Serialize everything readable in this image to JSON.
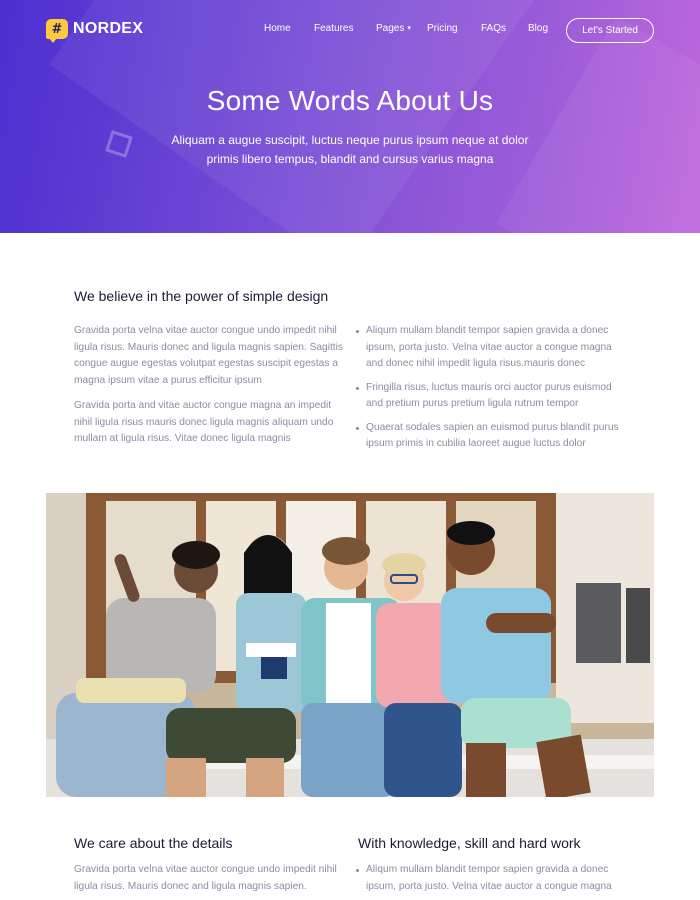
{
  "brand": {
    "logo_glyph": "#",
    "name": "NORDEX",
    "logo_color": "#ffc93c"
  },
  "nav": {
    "items": [
      {
        "label": "Home"
      },
      {
        "label": "Features"
      },
      {
        "label": "Pages"
      },
      {
        "label": "Pricing"
      },
      {
        "label": "FAQs"
      },
      {
        "label": "Blog"
      }
    ],
    "cta_label": "Let's Started"
  },
  "hero": {
    "title": "Some Words About Us",
    "subtitle": "Aliquam a augue suscipit, luctus neque purus ipsum neque at dolor primis libero tempus, blandit and cursus varius magna",
    "gradient_start": "#4b2fd0",
    "gradient_end": "#c069dd"
  },
  "section1": {
    "heading": "We believe in the power of simple design",
    "paragraphs": [
      "Gravida porta velna vitae auctor congue undo impedit nihil ligula risus. Mauris donec and ligula magnis sapien. Sagittis congue augue egestas volutpat egestas suscipit egestas a magna ipsum vitae a purus efficitur ipsum",
      "Gravida porta and vitae auctor congue magna an impedit nihil ligula risus mauris donec ligula magnis aliquam undo mullam at ligula risus. Vitae donec ligula magnis"
    ],
    "bullets": [
      "Aliqum mullam blandit tempor sapien gravida a donec ipsum, porta justo. Velna vitae auctor a congue magna and donec nihil impedit ligula risus.mauris donec",
      "Fringilla risus, luctus mauris orci auctor purus euismod and pretium purus pretium ligula rutrum tempor",
      "Quaerat sodales sapien an euismod purus blandit purus ipsum primis in cubilia laoreet augue luctus dolor"
    ]
  },
  "section2": {
    "left_heading": "We care about the details",
    "left_paragraph": "Gravida porta velna vitae auctor congue undo impedit nihil ligula risus. Mauris donec and ligula magnis sapien.",
    "right_heading": "With knowledge, skill and hard work",
    "right_bullet": "Aliqum mullam blandit tempor sapien gravida a donec ipsum, porta justo. Velna vitae auctor a congue magna"
  },
  "colors": {
    "heading_text": "#1f1a33",
    "body_text": "#8f8aa3"
  }
}
